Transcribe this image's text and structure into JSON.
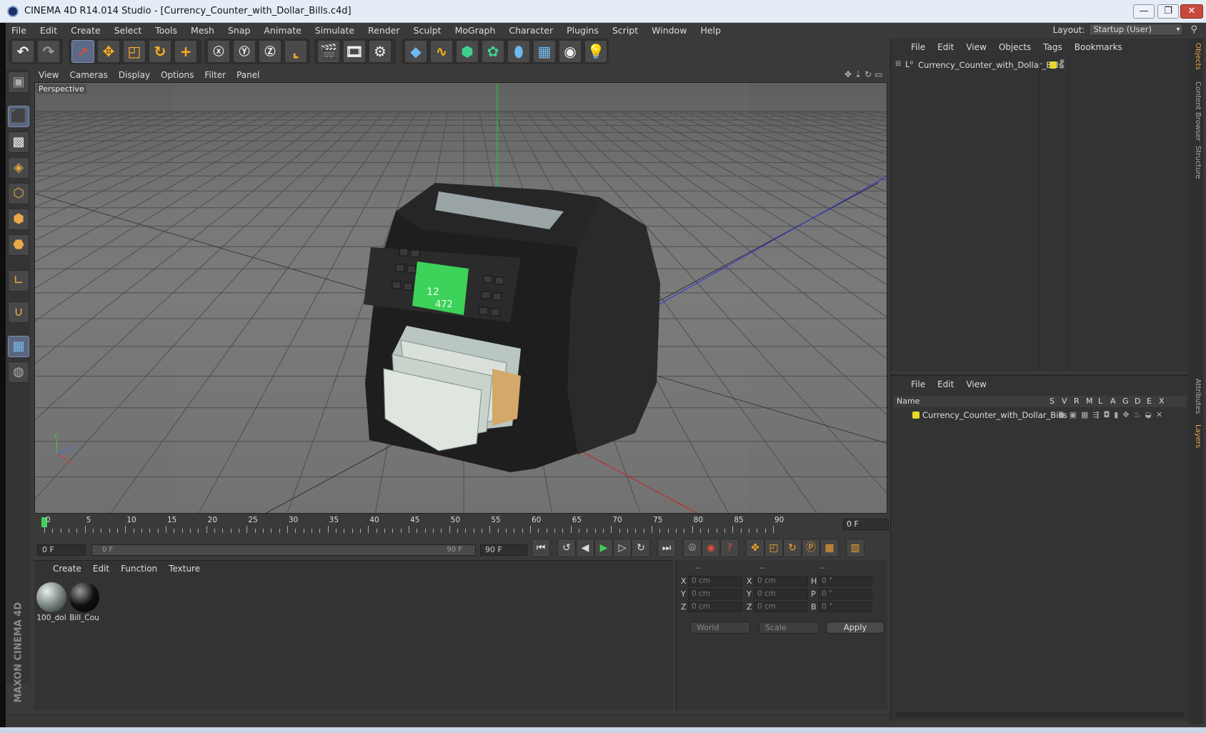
{
  "window": {
    "title": "CINEMA 4D R14.014 Studio - [Currency_Counter_with_Dollar_Bills.c4d]",
    "minimize": "—",
    "restore": "❐",
    "close": "✕"
  },
  "menubar": [
    "File",
    "Edit",
    "Create",
    "Select",
    "Tools",
    "Mesh",
    "Snap",
    "Animate",
    "Simulate",
    "Render",
    "Sculpt",
    "MoGraph",
    "Character",
    "Plugins",
    "Script",
    "Window",
    "Help"
  ],
  "layout": {
    "label": "Layout:",
    "value": "Startup (User)"
  },
  "viewport": {
    "menu": [
      "View",
      "Cameras",
      "Display",
      "Options",
      "Filter",
      "Panel"
    ],
    "label": "Perspective",
    "screen_lines": [
      "12",
      "472"
    ],
    "axis_y": "Y",
    "axis_z": "Z",
    "axis_x": "X"
  },
  "timeline": {
    "ticks": [
      "0",
      "5",
      "10",
      "15",
      "20",
      "25",
      "30",
      "35",
      "40",
      "45",
      "50",
      "55",
      "60",
      "65",
      "70",
      "75",
      "80",
      "85",
      "90"
    ],
    "current_frame": "0 F"
  },
  "transport": {
    "start": "0 F",
    "range_start": "0 F",
    "range_end": "90 F",
    "end": "90 F"
  },
  "material_panel": {
    "menu": [
      "Create",
      "Edit",
      "Function",
      "Texture"
    ],
    "materials": [
      {
        "name": "100_dol"
      },
      {
        "name": "Bill_Cou"
      }
    ]
  },
  "coord_panel": {
    "headers": [
      "--",
      "--",
      "--"
    ],
    "rows": [
      {
        "l1": "X",
        "v1": "0 cm",
        "l2": "X",
        "v2": "0 cm",
        "l3": "H",
        "v3": "0 °"
      },
      {
        "l1": "Y",
        "v1": "0 cm",
        "l2": "Y",
        "v2": "0 cm",
        "l3": "P",
        "v3": "0 °"
      },
      {
        "l1": "Z",
        "v1": "0 cm",
        "l2": "Z",
        "v2": "0 cm",
        "l3": "B",
        "v3": "0 °"
      }
    ],
    "mode1": "World",
    "mode2": "Scale",
    "apply": "Apply"
  },
  "object_panel": {
    "menu": [
      "File",
      "Edit",
      "View",
      "Objects",
      "Tags",
      "Bookmarks"
    ],
    "object_name": "Currency_Counter_with_Dollar_Bills",
    "tag_color": "#e8d82a"
  },
  "layer_panel": {
    "menu": [
      "File",
      "Edit",
      "View"
    ],
    "columns": [
      "Name",
      "S",
      "V",
      "R",
      "M",
      "L",
      "A",
      "G",
      "D",
      "E",
      "X"
    ],
    "layer_name": "Currency_Counter_with_Dollar_Bills"
  },
  "side_tabs": [
    "Objects",
    "Content Browser",
    "Structure",
    "Attributes",
    "Layers"
  ],
  "brand": "MAXON CINEMA 4D"
}
